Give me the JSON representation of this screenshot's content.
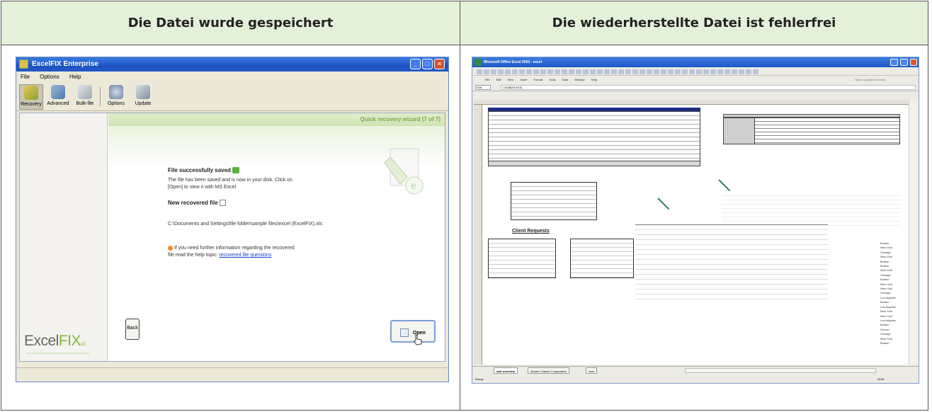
{
  "headers": {
    "left": "Die Datei wurde gespeichert",
    "right": "Die wiederherstellte Datei ist fehlerfrei"
  },
  "excelfix": {
    "window_title": "ExcelFIX Enterprise",
    "menu": [
      "File",
      "Options",
      "Help"
    ],
    "toolbar": [
      "Recovery",
      "Advanced",
      "Bulk-file",
      "Options",
      "Update"
    ],
    "wizard_label": "Quick recovery wizard (7 of 7)",
    "saved_title": "File successfully saved",
    "saved_text_1": "The file has been saved and is now in your disk. Click on",
    "saved_text_2": "[Open] to view it with MS Excel.",
    "new_file_title": "New recovered file",
    "new_file_path": "C:\\Documents and Settings\\file folder\\sample files\\excel (ExcelFIX).xls",
    "info_text_1": "If you need further information regarding the recovered",
    "info_text_2": "file read the help topic:",
    "info_link": "recovered file questions",
    "back_button": "Back",
    "open_button": "Open",
    "logo_excel": "Excel",
    "logo_fix": "FIX",
    "logo_version": "v1"
  },
  "excel": {
    "window_title": "Microsoft Office Excel 2003 - excel",
    "menu": [
      "File",
      "Edit",
      "View",
      "Insert",
      "Format",
      "Tools",
      "Data",
      "Window",
      "Help"
    ],
    "help_prompt": "Type a question for help",
    "name_box": "H16",
    "formula": "=SUM(H5:H14)",
    "heading": "Client Requests",
    "tabs": [
      "sale overview",
      "Modern Classic Comparative",
      "data"
    ],
    "status": "Ready",
    "status_right": "NUM",
    "cities": [
      "Boston",
      "New York",
      "Chicago",
      "New York",
      "Boston",
      "Boston",
      "New York",
      "Chicago",
      "Boston",
      "New York",
      "New York",
      "Chicago",
      "Los Angeles",
      "Boston",
      "Los Angeles",
      "New York",
      "New York",
      "Los Angeles",
      "Boston",
      "Denver",
      "Chicago",
      "New York",
      "Boston"
    ]
  },
  "colors": {
    "header_bg": "#e4f1d9",
    "xp_blue": "#1f58c6",
    "wizard_green": "#7ca748",
    "table_header_blue": "#1e2e82",
    "link_blue": "#1a44c8"
  }
}
